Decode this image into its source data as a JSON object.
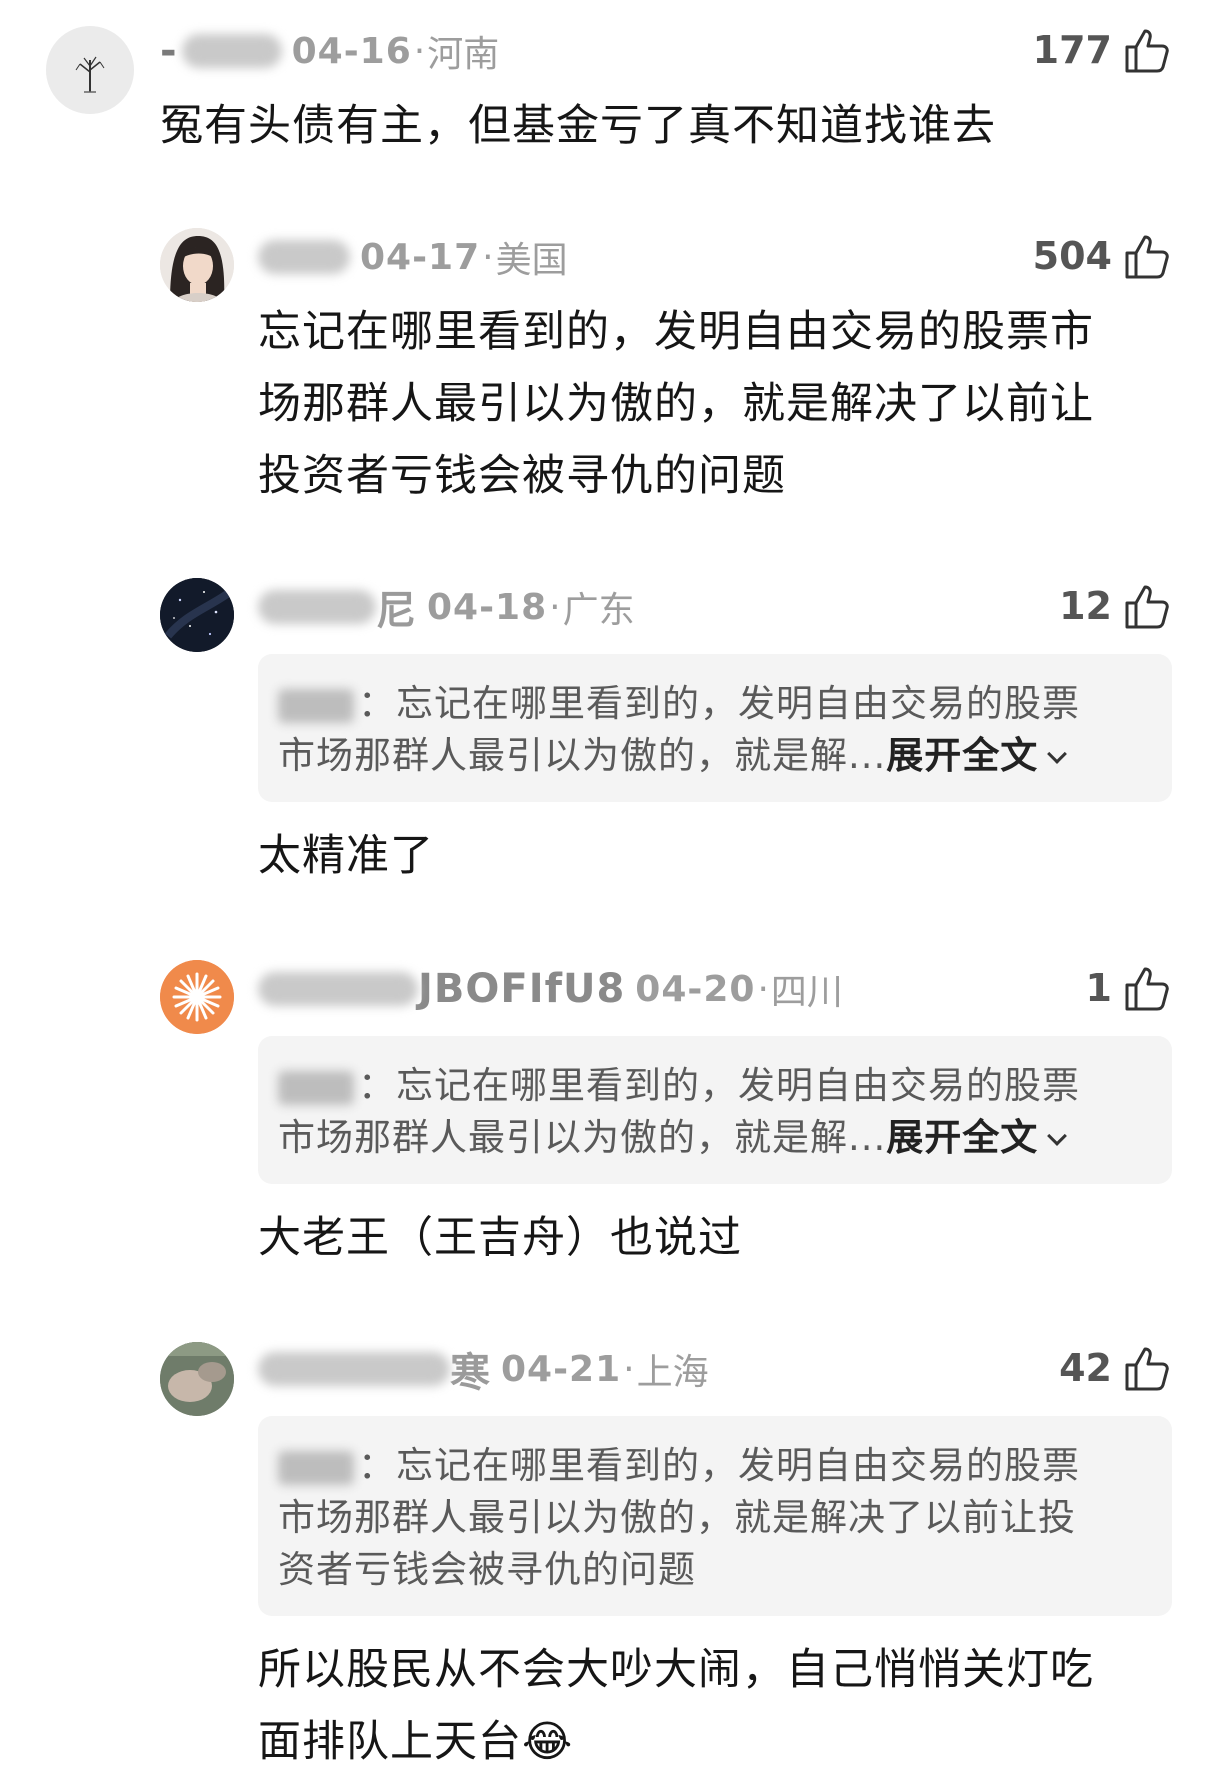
{
  "comments": [
    {
      "username_visible": "-",
      "date": "04-16",
      "location": "河南",
      "likes": "177",
      "text": "冤有头债有主，但基金亏了真不知道找谁去"
    },
    {
      "date": "04-17",
      "location": "美国",
      "likes": "504",
      "lines": [
        "忘记在哪里看到的，发明自由交易的股票市",
        "场那群人最引以为傲的，就是解决了以前让",
        "投资者亏钱会被寻仇的问题"
      ]
    },
    {
      "username_visible": "尼",
      "date": "04-18",
      "location": "广东",
      "likes": "12",
      "quote_line1": "：忘记在哪里看到的，发明自由交易的股票",
      "quote_line2": "市场那群人最引以为傲的，就是解...",
      "expand_label": "展开全文",
      "text": "太精准了"
    },
    {
      "username_visible": "JBOFIfU8",
      "date": "04-20",
      "location": "四川",
      "likes": "1",
      "quote_line1": "：忘记在哪里看到的，发明自由交易的股票",
      "quote_line2": "市场那群人最引以为傲的，就是解...",
      "expand_label": "展开全文",
      "text": "大老王（王吉舟）也说过"
    },
    {
      "username_visible": "寒",
      "date": "04-21",
      "location": "上海",
      "likes": "42",
      "quote_line1": "：忘记在哪里看到的，发明自由交易的股票",
      "quote_line2": "市场那群人最引以为傲的，就是解决了以前让投",
      "quote_line3": "资者亏钱会被寻仇的问题",
      "lines": [
        "所以股民从不会大吵大闹，自己悄悄关灯吃",
        "面排队上天台😂"
      ]
    }
  ],
  "separator": "·",
  "icons": {
    "like": "thumbs-up-icon"
  },
  "colors": {
    "meta": "#9d9d9d",
    "quote_bg": "#f4f4f4",
    "text": "#161616"
  }
}
